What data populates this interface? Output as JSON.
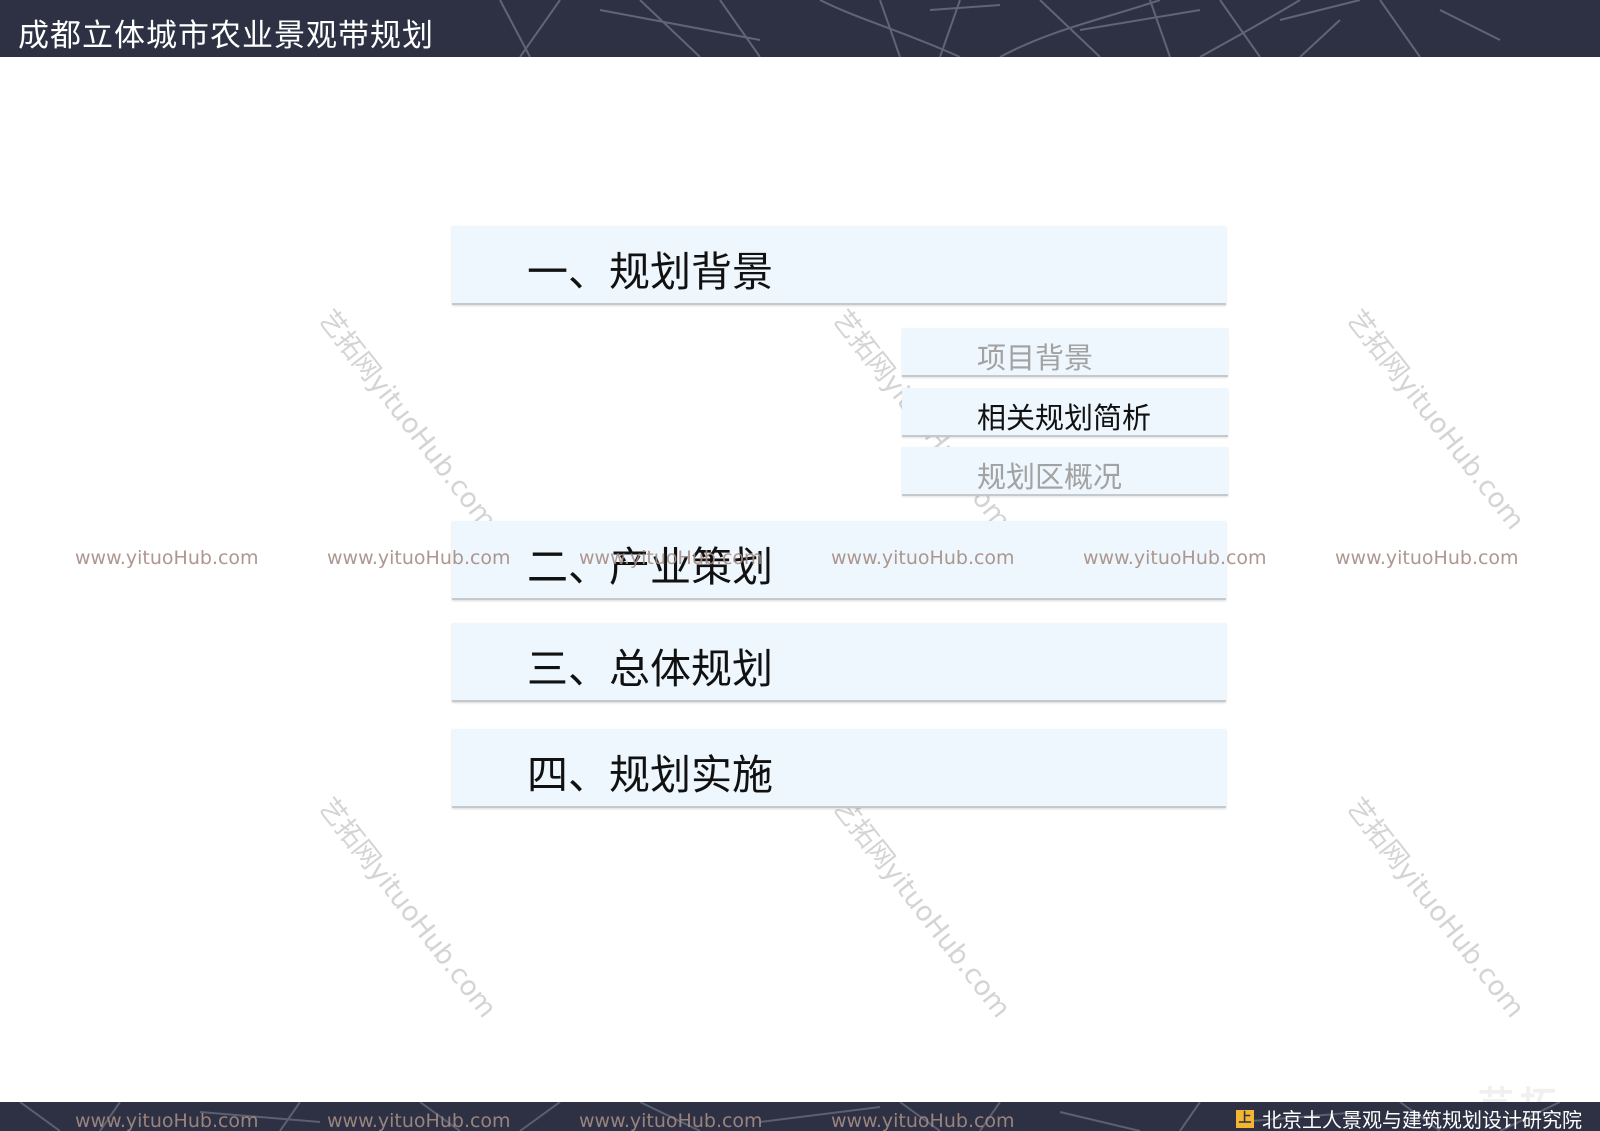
{
  "header": {
    "title": "成都立体城市农业景观带规划"
  },
  "menu": {
    "sections": [
      {
        "label": "一、规划背景"
      },
      {
        "label": "二、产业策划"
      },
      {
        "label": "三、总体规划"
      },
      {
        "label": "四、规划实施"
      }
    ],
    "subsections": [
      {
        "label": "项目背景",
        "state": "inactive"
      },
      {
        "label": "相关规划简析",
        "state": "active"
      },
      {
        "label": "规划区概况",
        "state": "inactive"
      }
    ]
  },
  "watermark": {
    "url": "www.yituoHub.com",
    "diagonal": "艺拓网yituoHub.com",
    "corner": "艺拓"
  },
  "footer": {
    "organization": "北京土人景观与建筑规划设计研究院",
    "logo_icon": "square-logo-icon"
  },
  "colors": {
    "bar_bg": "#2d3143",
    "item_bg": "#eef7fd",
    "dim_text": "#a2a2a2",
    "watermark": "#a58c84",
    "logo": "#f2b632"
  }
}
